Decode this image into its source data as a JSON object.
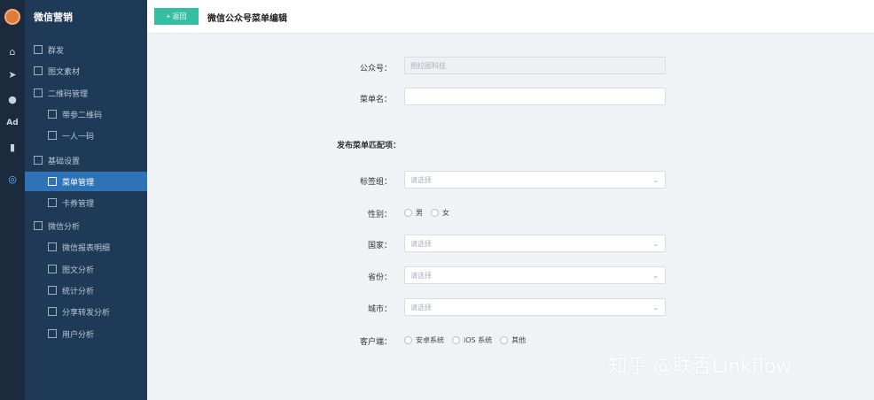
{
  "app": {
    "title": "微信营销",
    "accent_color": "#35bfa0",
    "sidebar_color": "#1f3a56",
    "active_color": "#2e73b8"
  },
  "iconbar": {
    "icons": [
      {
        "name": "home-icon",
        "glyph": "⌂"
      },
      {
        "name": "send-icon",
        "glyph": "➤"
      },
      {
        "name": "user-icon",
        "glyph": "●"
      },
      {
        "name": "ad-icon",
        "glyph": "Ad"
      },
      {
        "name": "bar-chart-icon",
        "glyph": "▮"
      },
      {
        "name": "wechat-icon",
        "glyph": "◎"
      }
    ]
  },
  "sidebar": {
    "items": [
      {
        "label": "群发",
        "icon": "megaphone-icon"
      },
      {
        "label": "图文素材",
        "icon": "document-icon"
      },
      {
        "label": "二维码管理",
        "icon": "folder-icon"
      },
      {
        "label": "带参二维码",
        "icon": "qrcode-icon"
      },
      {
        "label": "一人一码",
        "icon": "qrcode-icon"
      },
      {
        "label": "基础设置",
        "icon": "folder-icon"
      },
      {
        "label": "菜单管理",
        "icon": "list-icon"
      },
      {
        "label": "卡券管理",
        "icon": "card-icon"
      },
      {
        "label": "微信分析",
        "icon": "folder-icon"
      },
      {
        "label": "微信报表明细",
        "icon": "report-icon"
      },
      {
        "label": "图文分析",
        "icon": "document-icon"
      },
      {
        "label": "统计分析",
        "icon": "stats-icon"
      },
      {
        "label": "分享转发分析",
        "icon": "share-icon"
      },
      {
        "label": "用户分析",
        "icon": "users-icon"
      }
    ]
  },
  "header": {
    "back_label": "+ 返回",
    "title": "微信公众号菜单编辑"
  },
  "form": {
    "account_label": "公众号：",
    "account_value": "相拉图科技",
    "menu_name_label": "菜单名：",
    "menu_name_value": "",
    "section_title": "发布菜单匹配项：",
    "tag_group_label": "标签组：",
    "gender_label": "性别：",
    "gender_options": [
      "男",
      "女"
    ],
    "country_label": "国家：",
    "province_label": "省份：",
    "city_label": "城市：",
    "client_label": "客户端：",
    "client_options": [
      "安卓系统",
      "iOS 系统",
      "其他"
    ],
    "select_placeholder": "请选择"
  },
  "watermark": "知乎 @联否Linkflow"
}
